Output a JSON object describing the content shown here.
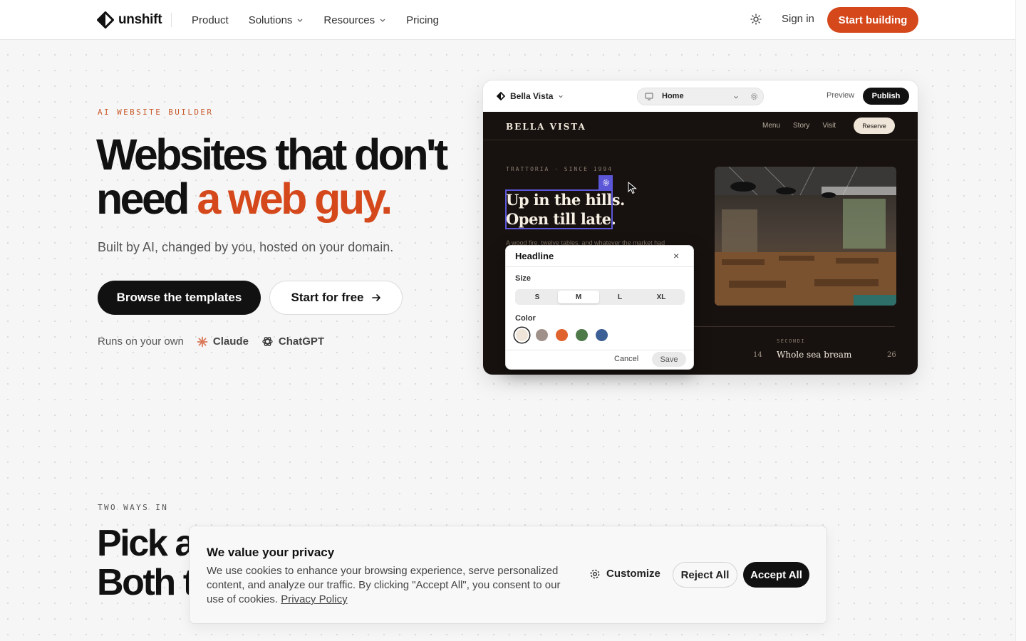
{
  "nav": {
    "logo_text": "unshift",
    "links": [
      {
        "label": "Product"
      },
      {
        "label": "Solutions"
      },
      {
        "label": "Resources"
      },
      {
        "label": "Pricing"
      }
    ],
    "signin": "Sign in",
    "cta": "Start building"
  },
  "hero": {
    "eyebrow": "AI WEBSITE BUILDER",
    "title_line1": "Websites that don't",
    "title_line2_plain": "need ",
    "title_line2_accent": "a web guy.",
    "subtitle": "Built by AI, changed by you, hosted on your domain.",
    "primary_button": "Browse the templates",
    "secondary_button": "Start for free",
    "runs_on": "Runs on your own",
    "brands": [
      "Claude",
      "ChatGPT"
    ]
  },
  "mockup": {
    "site_name": "Bella Vista",
    "page_selector": "Home",
    "preview": "Preview",
    "publish": "Publish",
    "site": {
      "brand": "BELLA VISTA",
      "nav": [
        "Menu",
        "Story",
        "Visit"
      ],
      "reserve": "Reserve",
      "eyebrow": "TRATTORIA · SINCE 1994",
      "headline_1": "Up in the hills.",
      "headline_2": "Open till late.",
      "paragraph": "A wood fire, twelve tables, and whatever the market had",
      "menu_left_price": "14",
      "menu_category": "SECONDI",
      "menu_item": "Whole sea bream",
      "menu_right_price": "26"
    },
    "popup": {
      "title": "Headline",
      "close": "×",
      "size_label": "Size",
      "sizes": [
        "S",
        "M",
        "L",
        "XL"
      ],
      "selected_size": "M",
      "color_label": "Color",
      "colors": [
        "#efe5d8",
        "#a0908a",
        "#e0622c",
        "#4e7a4a",
        "#3c5f95"
      ],
      "cancel": "Cancel",
      "save": "Save"
    }
  },
  "section2": {
    "eyebrow": "TWO WAYS IN",
    "title_line1": "Pick a",
    "title_line2": "Both t"
  },
  "cookie": {
    "title": "We value your privacy",
    "text": "We use cookies to enhance your browsing experience, serve personalized content, and analyze our traffic. By clicking \"Accept All\", you consent to our use of cookies. ",
    "link": "Privacy Policy",
    "customize": "Customize",
    "reject": "Reject All",
    "accept": "Accept All"
  },
  "colors": {
    "accent": "#d4481b",
    "dark": "#111111",
    "selection": "#5b56d8"
  }
}
